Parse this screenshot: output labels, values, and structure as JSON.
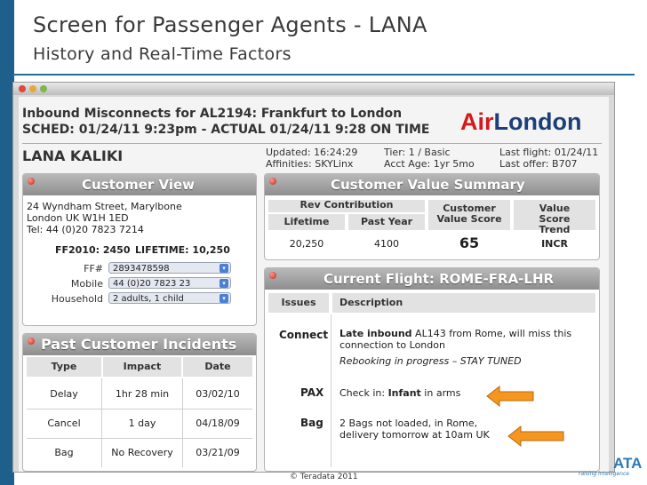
{
  "slide": {
    "title": "Screen for Passenger Agents - LANA",
    "subtitle": "History and Real-Time Factors",
    "footer": "© Teradata 2011",
    "brand": "ATA",
    "tagline": "raising intelligence"
  },
  "header": {
    "line1": "Inbound Misconnects for AL2194: Frankfurt to London",
    "line2": "SCHED: 01/24/11 9:23pm  -  ACTUAL 01/24/11 9:28 ON TIME",
    "logo_air": "Air",
    "logo_london": "London"
  },
  "passenger": {
    "name": "LANA KALIKI",
    "updated": "Updated: 16:24:29",
    "affinities": "Affinities: SKYLinx",
    "tier": "Tier: 1 / Basic",
    "acct_age": "Acct Age: 1yr 5mo",
    "last_flight": "Last flight: 01/24/11",
    "last_offer": "Last offer:  B707"
  },
  "customer_view": {
    "title": "Customer View",
    "address1": "24 Wyndham Street, Marylbone",
    "address2": "London UK W1H 1ED",
    "tel": "Tel: 44 (0)20 7823 7214",
    "ff_label": "FF2010: 2450",
    "lifetime_label": "LIFETIME: 10,250",
    "fields": [
      {
        "label": "FF#",
        "value": "2893478598"
      },
      {
        "label": "Mobile",
        "value": "44 (0)20 7823 23"
      },
      {
        "label": "Household",
        "value": "2 adults, 1 child"
      }
    ]
  },
  "value_summary": {
    "title": "Customer Value Summary",
    "rev_contribution": "Rev Contribution",
    "headers": [
      "Lifetime",
      "Past Year",
      "Customer Value Score",
      "Value Score Trend"
    ],
    "values": [
      "20,250",
      "4100",
      "65",
      "INCR"
    ]
  },
  "incidents": {
    "title": "Past Customer Incidents",
    "headers": [
      "Type",
      "Impact",
      "Date"
    ],
    "rows": [
      {
        "type": "Delay",
        "impact": "1hr 28 min",
        "date": "03/02/10"
      },
      {
        "type": "Cancel",
        "impact": "1 day",
        "date": "04/18/09"
      },
      {
        "type": "Bag",
        "impact": "No Recovery",
        "date": "03/21/09"
      }
    ]
  },
  "current_flight": {
    "title": "Current Flight: ROME-FRA-LHR",
    "headers": [
      "Issues",
      "Description"
    ],
    "connect_label": "Connect",
    "connect_bold": "Late inbound",
    "connect_rest": " AL143 from Rome, will miss this",
    "connect_line2": "connection to London",
    "connect_line3": "Rebooking in progress – STAY TUNED",
    "pax_label": "PAX",
    "pax_pre": "Check in: ",
    "pax_bold": "Infant",
    "pax_post": " in arms",
    "bag_label": "Bag",
    "bag_line1": "2 Bags not loaded, in Rome,",
    "bag_line2": "delivery tomorrow at 10am UK"
  },
  "colors": {
    "accent_blue": "#1f5f8b",
    "arrow_orange": "#f5961e",
    "logo_red": "#d11b1b",
    "logo_navy": "#1c3f7a"
  }
}
